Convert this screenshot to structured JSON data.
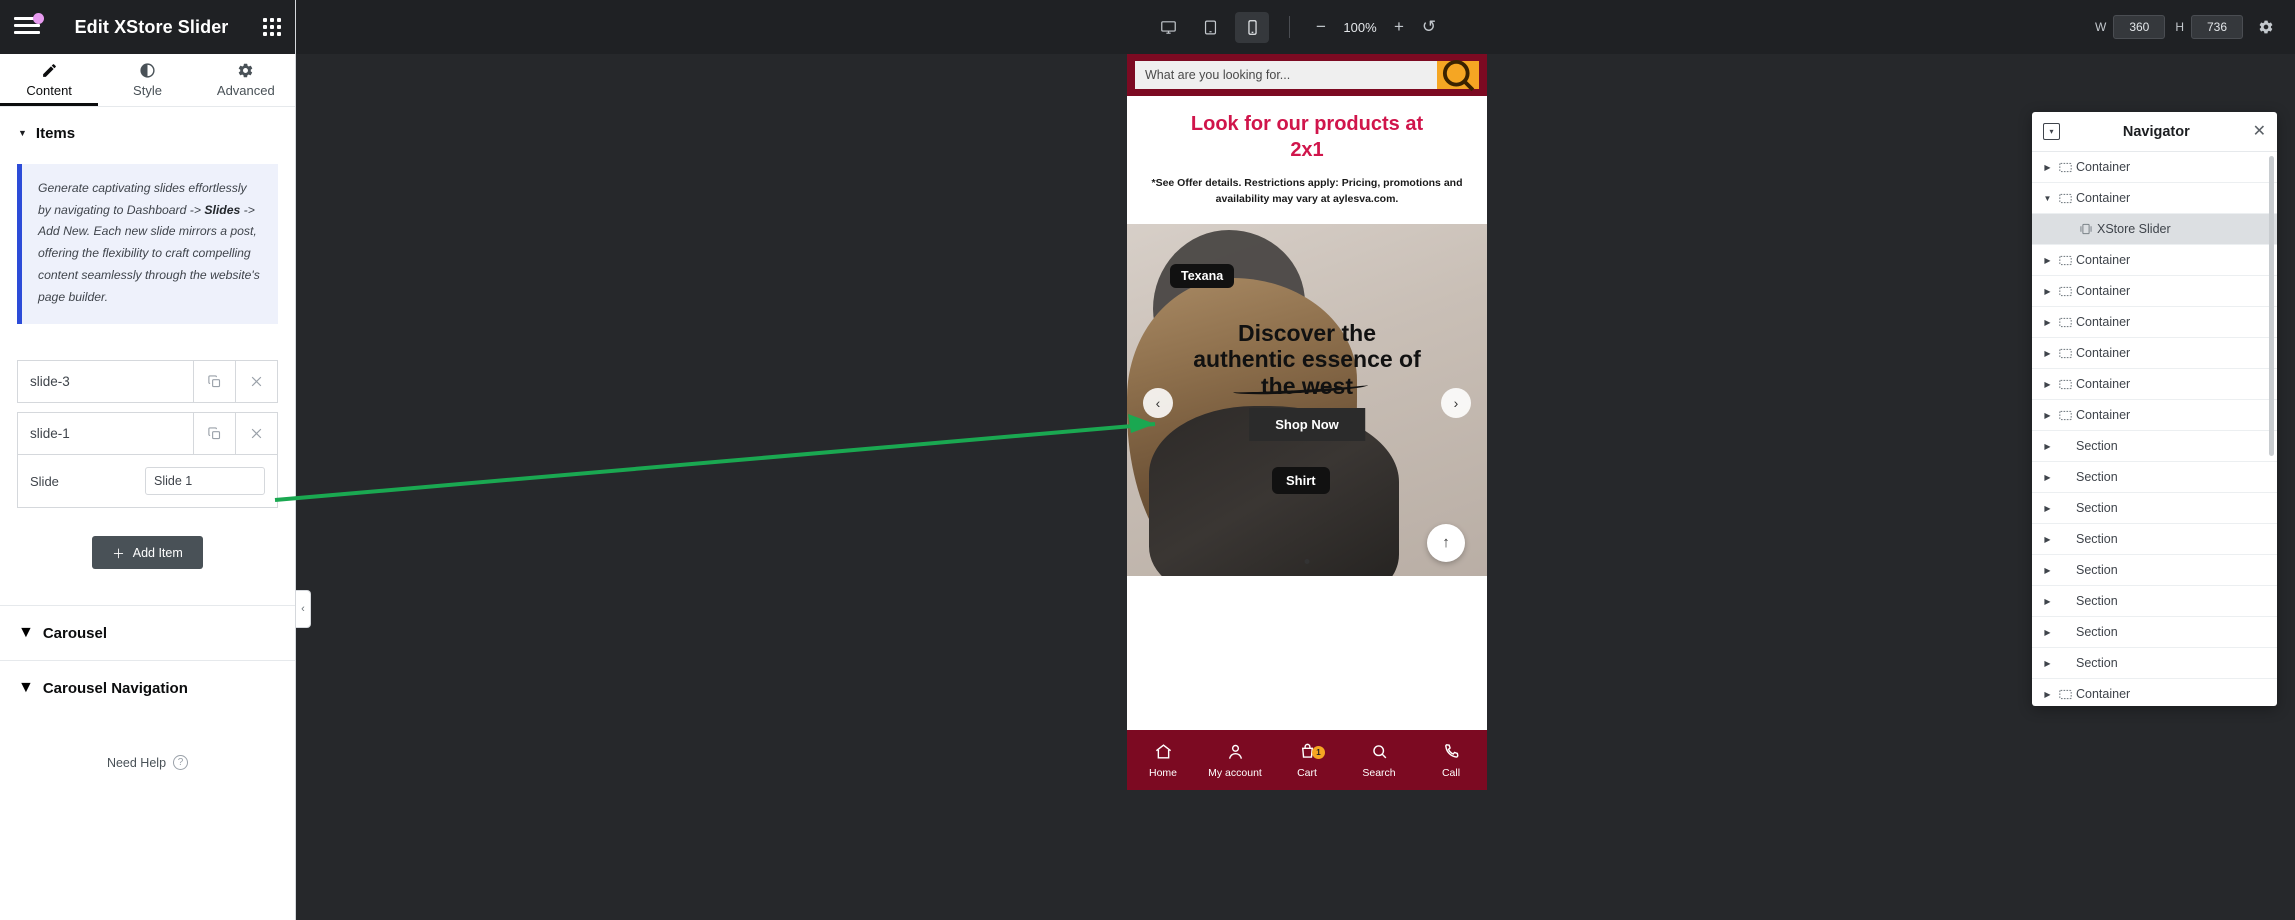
{
  "panel": {
    "title": "Edit XStore Slider",
    "menu_icon": "hamburger-icon",
    "apps_icon": "grid-apps-icon",
    "tabs": [
      {
        "label": "Content",
        "icon": "pencil-icon",
        "active": true
      },
      {
        "label": "Style",
        "icon": "contrast-icon",
        "active": false
      },
      {
        "label": "Advanced",
        "icon": "gear-icon",
        "active": false
      }
    ],
    "sections": {
      "items": {
        "title": "Items",
        "expanded": true,
        "notice_prefix": "Generate captivating slides effortlessly by navigating to Dashboard -> ",
        "notice_bold": "Slides",
        "notice_suffix": " -> Add New. Each new slide mirrors a post, offering the flexibility to craft compelling content seamlessly through the website's page builder.",
        "repeater": [
          {
            "title": "slide-3",
            "duplicate_icon": "copy-icon",
            "remove_icon": "close-icon"
          },
          {
            "title": "slide-1",
            "duplicate_icon": "copy-icon",
            "remove_icon": "close-icon"
          }
        ],
        "open_item_field": {
          "label": "Slide",
          "value": "Slide 1",
          "placeholder": ""
        },
        "add_item_label": "Add Item",
        "add_item_icon": "plus-icon"
      },
      "carousel": {
        "title": "Carousel",
        "expanded": false
      },
      "carousel_navigation": {
        "title": "Carousel Navigation",
        "expanded": false
      }
    },
    "need_help": {
      "label": "Need Help",
      "icon": "question-circle-icon"
    },
    "collapse_icon": "chevron-left-icon"
  },
  "topbar": {
    "devices": [
      {
        "name": "desktop-icon",
        "active": false
      },
      {
        "name": "tablet-icon",
        "active": false
      },
      {
        "name": "mobile-icon",
        "active": true
      }
    ],
    "zoom_out_icon": "minus-icon",
    "zoom_value": "100%",
    "zoom_in_icon": "plus-icon",
    "reset_icon": "reset-icon",
    "width_label": "W",
    "width_value": "360",
    "height_label": "H",
    "height_value": "736",
    "settings_icon": "gear-icon"
  },
  "preview": {
    "search": {
      "placeholder": "What are you looking for...",
      "value": "What are you looking for...",
      "button_icon": "search-icon"
    },
    "promo": {
      "heading_line1": "Look for our products at",
      "heading_line2": "2x1",
      "disclaimer": "*See Offer details. Restrictions apply: Pricing, promotions and availability may vary at aylesva.com."
    },
    "hero": {
      "tag_top": "Texana",
      "tag_bottom": "Shirt",
      "headline_line1": "Discover the",
      "headline_line2": "authentic essence of",
      "headline_line3": "the west",
      "cta": "Shop Now",
      "prev_icon": "chevron-left-icon",
      "next_icon": "chevron-right-icon",
      "scroll_top_icon": "arrow-up-icon"
    },
    "bottom_nav": [
      {
        "label": "Home",
        "icon": "home-icon",
        "badge": ""
      },
      {
        "label": "My account",
        "icon": "user-icon",
        "badge": ""
      },
      {
        "label": "Cart",
        "icon": "cart-icon",
        "badge": "1"
      },
      {
        "label": "Search",
        "icon": "search-icon",
        "badge": ""
      },
      {
        "label": "Call",
        "icon": "phone-icon",
        "badge": ""
      }
    ]
  },
  "navigator": {
    "title": "Navigator",
    "dock_icon": "dock-icon",
    "close_icon": "close-icon",
    "items": [
      {
        "label": "Container",
        "depth": 0,
        "expanded": false,
        "icon": "container-icon",
        "selected": false
      },
      {
        "label": "Container",
        "depth": 0,
        "expanded": true,
        "icon": "container-icon",
        "selected": false
      },
      {
        "label": "XStore Slider",
        "depth": 1,
        "expanded": null,
        "icon": "slider-icon",
        "selected": true
      },
      {
        "label": "Container",
        "depth": 0,
        "expanded": false,
        "icon": "container-icon",
        "selected": false
      },
      {
        "label": "Container",
        "depth": 0,
        "expanded": false,
        "icon": "container-icon",
        "selected": false
      },
      {
        "label": "Container",
        "depth": 0,
        "expanded": false,
        "icon": "container-icon",
        "selected": false
      },
      {
        "label": "Container",
        "depth": 0,
        "expanded": false,
        "icon": "container-icon",
        "selected": false
      },
      {
        "label": "Container",
        "depth": 0,
        "expanded": false,
        "icon": "container-icon",
        "selected": false
      },
      {
        "label": "Container",
        "depth": 0,
        "expanded": false,
        "icon": "container-icon",
        "selected": false
      },
      {
        "label": "Section",
        "depth": 0,
        "expanded": false,
        "icon": "section-icon",
        "selected": false
      },
      {
        "label": "Section",
        "depth": 0,
        "expanded": false,
        "icon": "section-icon",
        "selected": false
      },
      {
        "label": "Section",
        "depth": 0,
        "expanded": false,
        "icon": "section-icon",
        "selected": false
      },
      {
        "label": "Section",
        "depth": 0,
        "expanded": false,
        "icon": "section-icon",
        "selected": false
      },
      {
        "label": "Section",
        "depth": 0,
        "expanded": false,
        "icon": "section-icon",
        "selected": false
      },
      {
        "label": "Section",
        "depth": 0,
        "expanded": false,
        "icon": "section-icon",
        "selected": false
      },
      {
        "label": "Section",
        "depth": 0,
        "expanded": false,
        "icon": "section-icon",
        "selected": false
      },
      {
        "label": "Section",
        "depth": 0,
        "expanded": false,
        "icon": "section-icon",
        "selected": false
      },
      {
        "label": "Container",
        "depth": 0,
        "expanded": false,
        "icon": "container-icon",
        "selected": false
      }
    ]
  }
}
